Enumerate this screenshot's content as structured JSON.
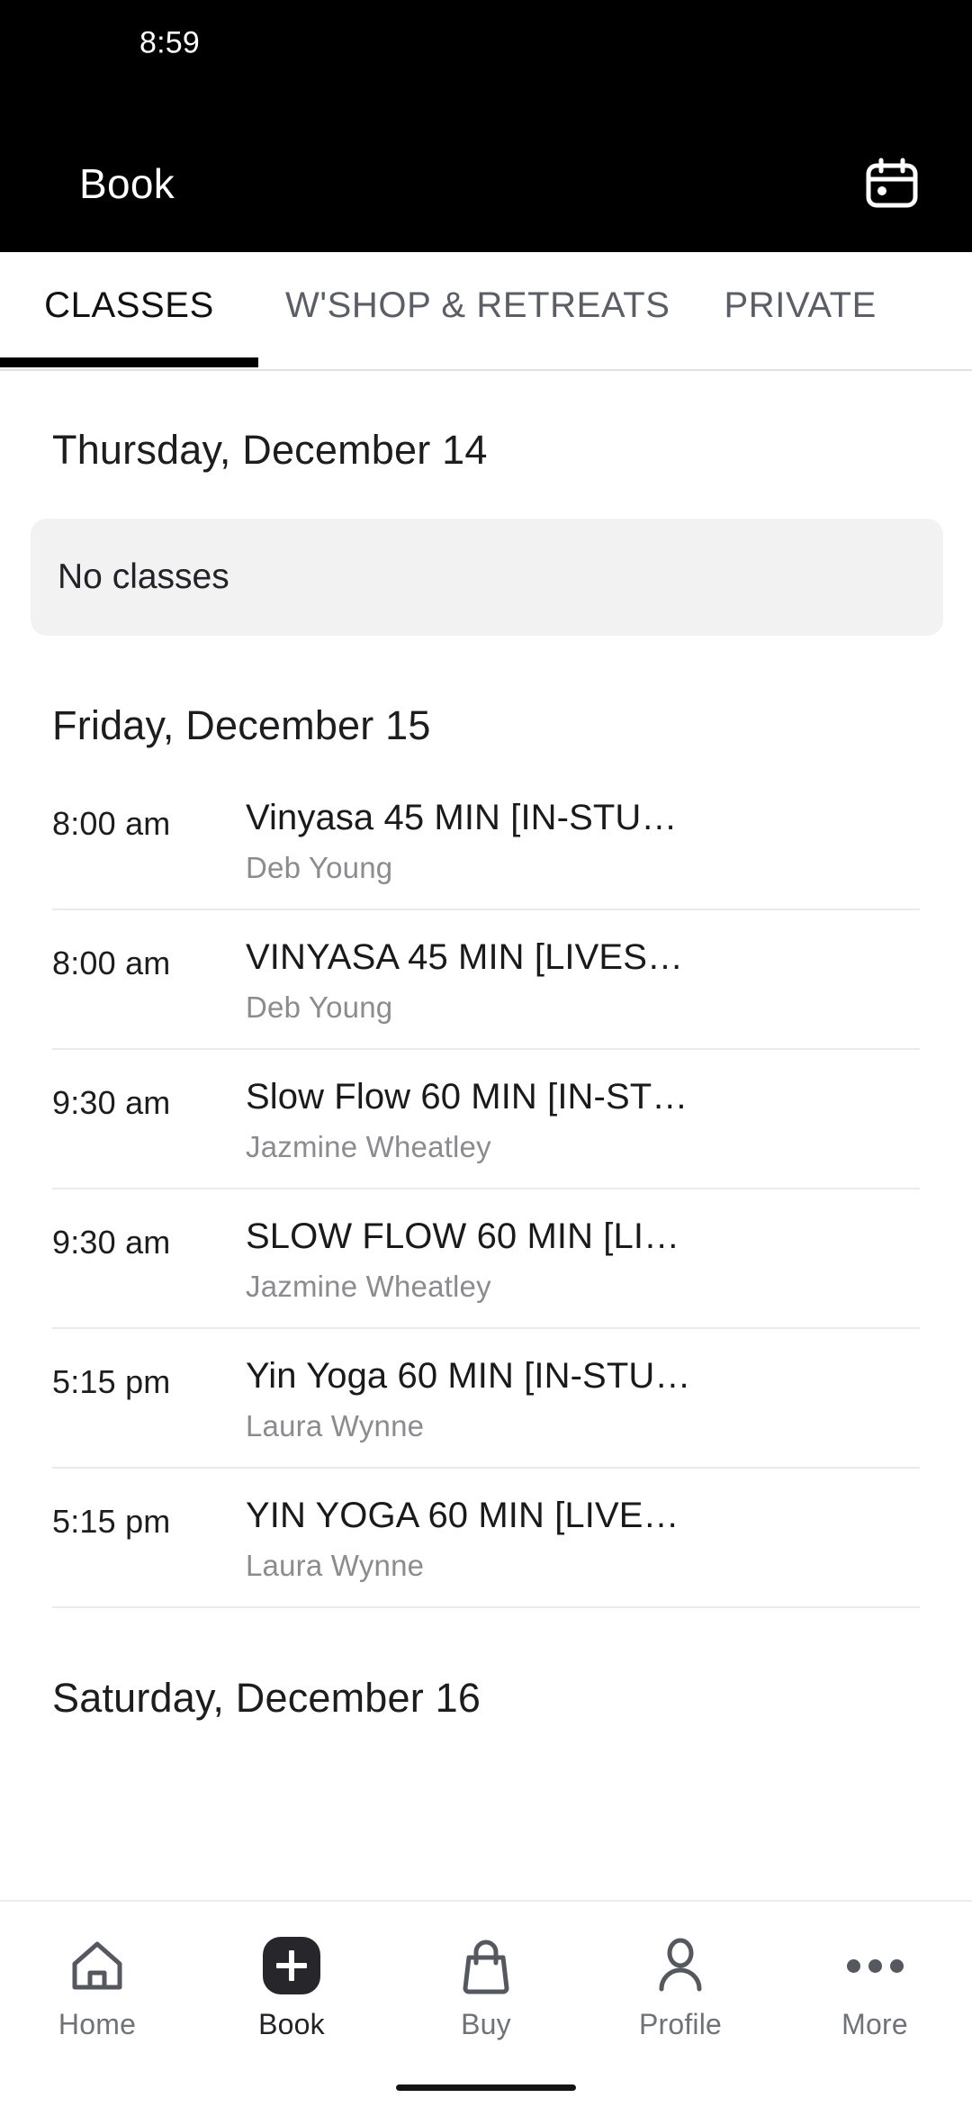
{
  "status_bar": {
    "time": "8:59"
  },
  "app_bar": {
    "title": "Book",
    "calendar_icon": "calendar-icon"
  },
  "tabs": [
    {
      "label": "CLASSES",
      "active": true
    },
    {
      "label": "W'SHOP & RETREATS",
      "active": false
    },
    {
      "label": "PRIVATE",
      "active": false
    }
  ],
  "days": [
    {
      "date_label": "Thursday, December 14",
      "empty_label": "No classes",
      "classes": []
    },
    {
      "date_label": "Friday, December 15",
      "empty_label": "",
      "classes": [
        {
          "time": "8:00 am",
          "title": "Vinyasa 45 MIN [IN-STU…",
          "teacher": "Deb Young"
        },
        {
          "time": "8:00 am",
          "title": "VINYASA 45 MIN [LIVES…",
          "teacher": "Deb Young"
        },
        {
          "time": "9:30 am",
          "title": "Slow Flow 60 MIN [IN-ST…",
          "teacher": "Jazmine Wheatley"
        },
        {
          "time": "9:30 am",
          "title": "SLOW FLOW 60 MIN [LI…",
          "teacher": "Jazmine Wheatley"
        },
        {
          "time": "5:15 pm",
          "title": "Yin Yoga 60 MIN [IN-STU…",
          "teacher": "Laura Wynne"
        },
        {
          "time": "5:15 pm",
          "title": "YIN YOGA 60 MIN [LIVE…",
          "teacher": "Laura Wynne"
        }
      ]
    },
    {
      "date_label": "Saturday, December 16",
      "empty_label": "",
      "classes": []
    }
  ],
  "bottom_nav": [
    {
      "label": "Home",
      "icon": "home-icon",
      "active": false
    },
    {
      "label": "Book",
      "icon": "plus-badge-icon",
      "active": true
    },
    {
      "label": "Buy",
      "icon": "shopping-bag-icon",
      "active": false
    },
    {
      "label": "Profile",
      "icon": "person-icon",
      "active": false
    },
    {
      "label": "More",
      "icon": "ellipsis-icon",
      "active": false
    }
  ],
  "colors": {
    "appbar_background": "#000000",
    "accent": "#000000",
    "empty_card_background": "#f2f2f2",
    "muted_text": "#8b8b90",
    "nav_inactive": "#6f7278",
    "nav_active": "#232327",
    "book_badge": "#27272b",
    "divider": "#ebebeb"
  }
}
